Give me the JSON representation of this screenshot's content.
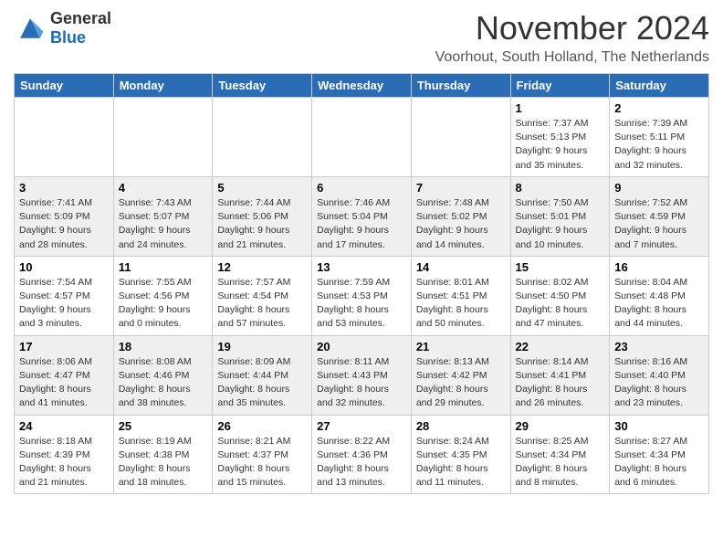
{
  "header": {
    "logo_general": "General",
    "logo_blue": "Blue",
    "month_title": "November 2024",
    "location": "Voorhout, South Holland, The Netherlands"
  },
  "days_of_week": [
    "Sunday",
    "Monday",
    "Tuesday",
    "Wednesday",
    "Thursday",
    "Friday",
    "Saturday"
  ],
  "weeks": [
    [
      {
        "day": "",
        "sunrise": "",
        "sunset": "",
        "daylight": ""
      },
      {
        "day": "",
        "sunrise": "",
        "sunset": "",
        "daylight": ""
      },
      {
        "day": "",
        "sunrise": "",
        "sunset": "",
        "daylight": ""
      },
      {
        "day": "",
        "sunrise": "",
        "sunset": "",
        "daylight": ""
      },
      {
        "day": "",
        "sunrise": "",
        "sunset": "",
        "daylight": ""
      },
      {
        "day": "1",
        "sunrise": "Sunrise: 7:37 AM",
        "sunset": "Sunset: 5:13 PM",
        "daylight": "Daylight: 9 hours and 35 minutes."
      },
      {
        "day": "2",
        "sunrise": "Sunrise: 7:39 AM",
        "sunset": "Sunset: 5:11 PM",
        "daylight": "Daylight: 9 hours and 32 minutes."
      }
    ],
    [
      {
        "day": "3",
        "sunrise": "Sunrise: 7:41 AM",
        "sunset": "Sunset: 5:09 PM",
        "daylight": "Daylight: 9 hours and 28 minutes."
      },
      {
        "day": "4",
        "sunrise": "Sunrise: 7:43 AM",
        "sunset": "Sunset: 5:07 PM",
        "daylight": "Daylight: 9 hours and 24 minutes."
      },
      {
        "day": "5",
        "sunrise": "Sunrise: 7:44 AM",
        "sunset": "Sunset: 5:06 PM",
        "daylight": "Daylight: 9 hours and 21 minutes."
      },
      {
        "day": "6",
        "sunrise": "Sunrise: 7:46 AM",
        "sunset": "Sunset: 5:04 PM",
        "daylight": "Daylight: 9 hours and 17 minutes."
      },
      {
        "day": "7",
        "sunrise": "Sunrise: 7:48 AM",
        "sunset": "Sunset: 5:02 PM",
        "daylight": "Daylight: 9 hours and 14 minutes."
      },
      {
        "day": "8",
        "sunrise": "Sunrise: 7:50 AM",
        "sunset": "Sunset: 5:01 PM",
        "daylight": "Daylight: 9 hours and 10 minutes."
      },
      {
        "day": "9",
        "sunrise": "Sunrise: 7:52 AM",
        "sunset": "Sunset: 4:59 PM",
        "daylight": "Daylight: 9 hours and 7 minutes."
      }
    ],
    [
      {
        "day": "10",
        "sunrise": "Sunrise: 7:54 AM",
        "sunset": "Sunset: 4:57 PM",
        "daylight": "Daylight: 9 hours and 3 minutes."
      },
      {
        "day": "11",
        "sunrise": "Sunrise: 7:55 AM",
        "sunset": "Sunset: 4:56 PM",
        "daylight": "Daylight: 9 hours and 0 minutes."
      },
      {
        "day": "12",
        "sunrise": "Sunrise: 7:57 AM",
        "sunset": "Sunset: 4:54 PM",
        "daylight": "Daylight: 8 hours and 57 minutes."
      },
      {
        "day": "13",
        "sunrise": "Sunrise: 7:59 AM",
        "sunset": "Sunset: 4:53 PM",
        "daylight": "Daylight: 8 hours and 53 minutes."
      },
      {
        "day": "14",
        "sunrise": "Sunrise: 8:01 AM",
        "sunset": "Sunset: 4:51 PM",
        "daylight": "Daylight: 8 hours and 50 minutes."
      },
      {
        "day": "15",
        "sunrise": "Sunrise: 8:02 AM",
        "sunset": "Sunset: 4:50 PM",
        "daylight": "Daylight: 8 hours and 47 minutes."
      },
      {
        "day": "16",
        "sunrise": "Sunrise: 8:04 AM",
        "sunset": "Sunset: 4:48 PM",
        "daylight": "Daylight: 8 hours and 44 minutes."
      }
    ],
    [
      {
        "day": "17",
        "sunrise": "Sunrise: 8:06 AM",
        "sunset": "Sunset: 4:47 PM",
        "daylight": "Daylight: 8 hours and 41 minutes."
      },
      {
        "day": "18",
        "sunrise": "Sunrise: 8:08 AM",
        "sunset": "Sunset: 4:46 PM",
        "daylight": "Daylight: 8 hours and 38 minutes."
      },
      {
        "day": "19",
        "sunrise": "Sunrise: 8:09 AM",
        "sunset": "Sunset: 4:44 PM",
        "daylight": "Daylight: 8 hours and 35 minutes."
      },
      {
        "day": "20",
        "sunrise": "Sunrise: 8:11 AM",
        "sunset": "Sunset: 4:43 PM",
        "daylight": "Daylight: 8 hours and 32 minutes."
      },
      {
        "day": "21",
        "sunrise": "Sunrise: 8:13 AM",
        "sunset": "Sunset: 4:42 PM",
        "daylight": "Daylight: 8 hours and 29 minutes."
      },
      {
        "day": "22",
        "sunrise": "Sunrise: 8:14 AM",
        "sunset": "Sunset: 4:41 PM",
        "daylight": "Daylight: 8 hours and 26 minutes."
      },
      {
        "day": "23",
        "sunrise": "Sunrise: 8:16 AM",
        "sunset": "Sunset: 4:40 PM",
        "daylight": "Daylight: 8 hours and 23 minutes."
      }
    ],
    [
      {
        "day": "24",
        "sunrise": "Sunrise: 8:18 AM",
        "sunset": "Sunset: 4:39 PM",
        "daylight": "Daylight: 8 hours and 21 minutes."
      },
      {
        "day": "25",
        "sunrise": "Sunrise: 8:19 AM",
        "sunset": "Sunset: 4:38 PM",
        "daylight": "Daylight: 8 hours and 18 minutes."
      },
      {
        "day": "26",
        "sunrise": "Sunrise: 8:21 AM",
        "sunset": "Sunset: 4:37 PM",
        "daylight": "Daylight: 8 hours and 15 minutes."
      },
      {
        "day": "27",
        "sunrise": "Sunrise: 8:22 AM",
        "sunset": "Sunset: 4:36 PM",
        "daylight": "Daylight: 8 hours and 13 minutes."
      },
      {
        "day": "28",
        "sunrise": "Sunrise: 8:24 AM",
        "sunset": "Sunset: 4:35 PM",
        "daylight": "Daylight: 8 hours and 11 minutes."
      },
      {
        "day": "29",
        "sunrise": "Sunrise: 8:25 AM",
        "sunset": "Sunset: 4:34 PM",
        "daylight": "Daylight: 8 hours and 8 minutes."
      },
      {
        "day": "30",
        "sunrise": "Sunrise: 8:27 AM",
        "sunset": "Sunset: 4:34 PM",
        "daylight": "Daylight: 8 hours and 6 minutes."
      }
    ]
  ]
}
